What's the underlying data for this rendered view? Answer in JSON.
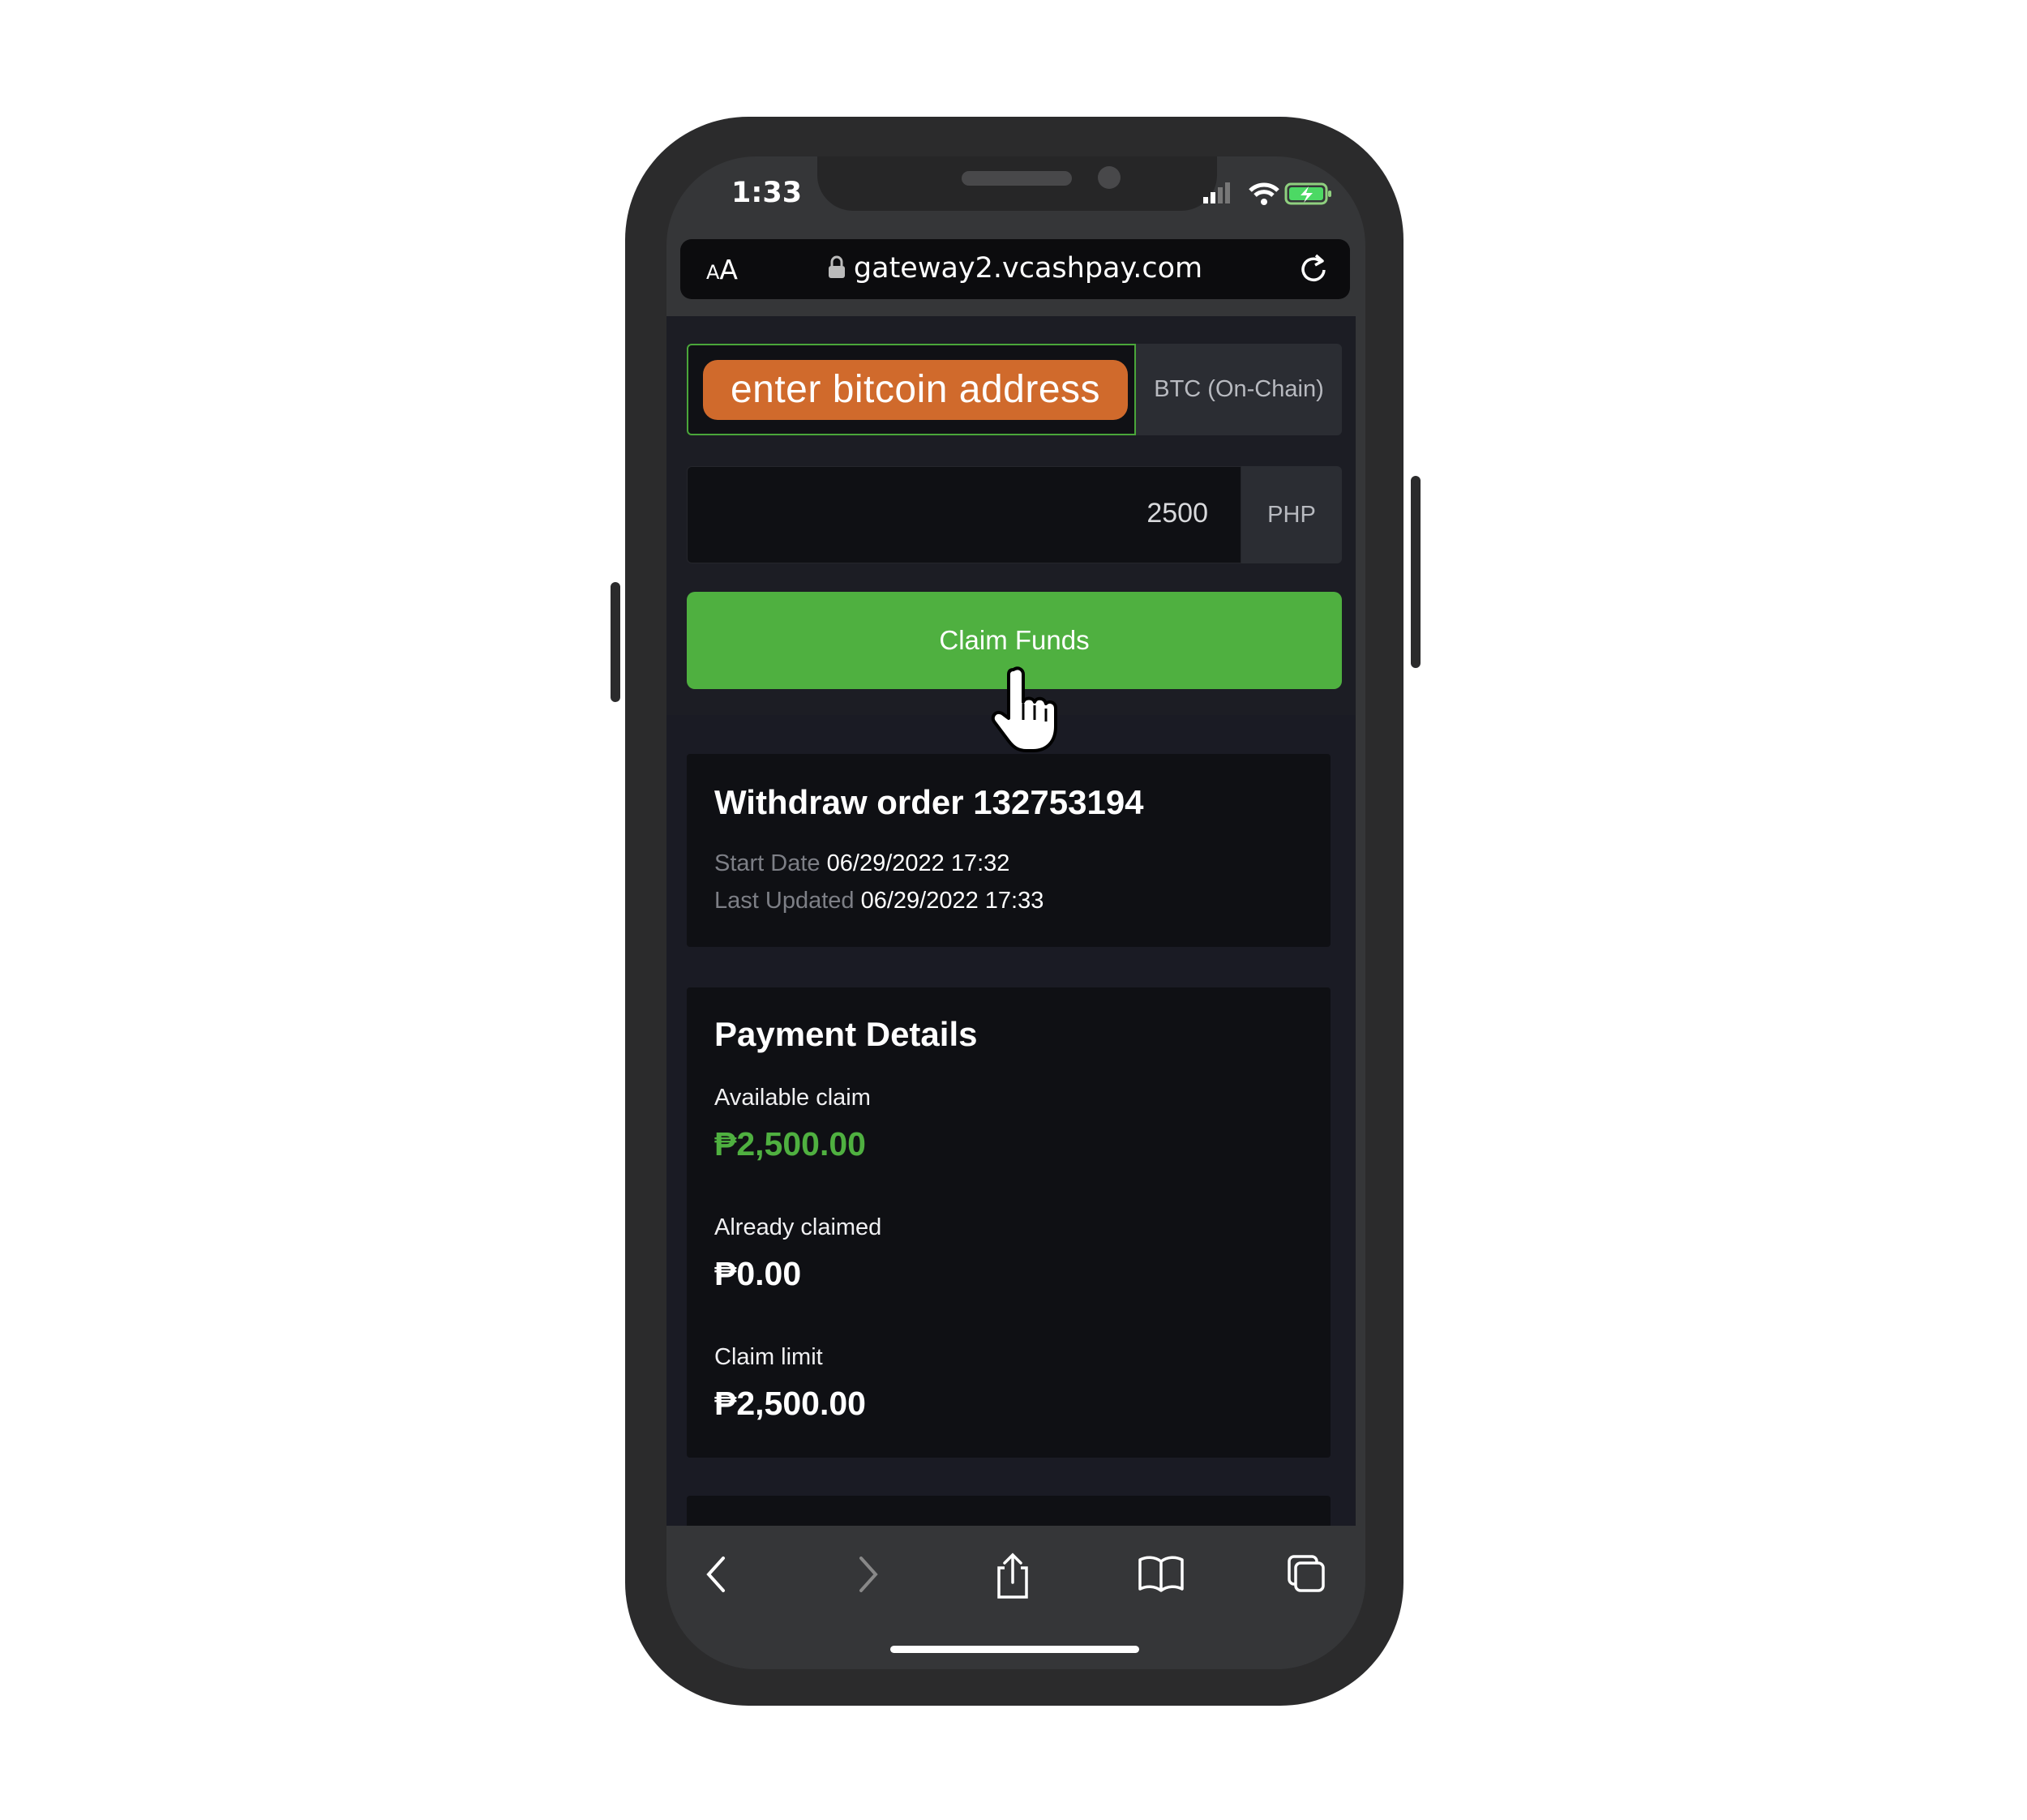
{
  "status_bar": {
    "time": "1:33"
  },
  "browser": {
    "text_size_label_small": "A",
    "text_size_label_large": "A",
    "url": "gateway2.vcashpay.com"
  },
  "form": {
    "address_label": "enter bitcoin address",
    "address_network": "BTC (On-Chain)",
    "amount_value": "2500",
    "amount_currency": "PHP",
    "claim_button_label": "Claim Funds"
  },
  "order": {
    "title": "Withdraw order 132753194",
    "start_date_label": "Start Date",
    "start_date_value": "06/29/2022 17:32",
    "last_updated_label": "Last Updated",
    "last_updated_value": "06/29/2022 17:33"
  },
  "payment": {
    "title": "Payment Details",
    "available_label": "Available claim",
    "available_value": "₱2,500.00",
    "claimed_label": "Already claimed",
    "claimed_value": "₱0.00",
    "limit_label": "Claim limit",
    "limit_value": "₱2,500.00"
  },
  "colors": {
    "accent_green": "#4fb040",
    "address_tag_orange": "#d06a2c",
    "page_background": "#1a1b24"
  }
}
